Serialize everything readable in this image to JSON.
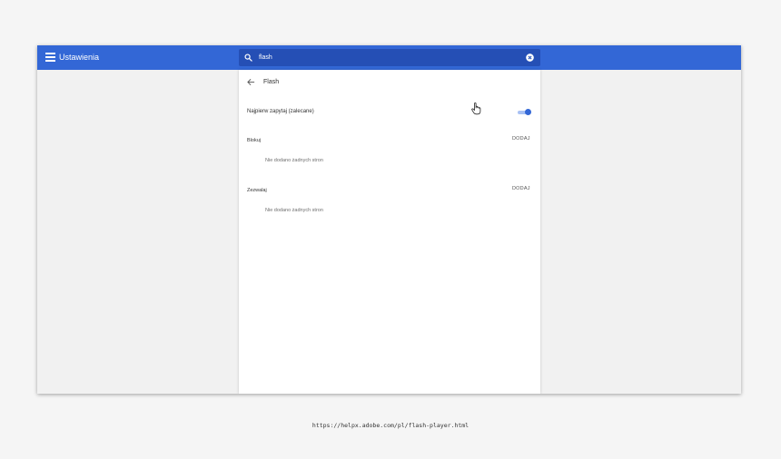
{
  "header": {
    "title": "Ustawienia",
    "menu_icon": "hamburger-menu-icon",
    "accent_color": "#3367d6"
  },
  "search": {
    "value": "flash",
    "search_icon": "search-icon",
    "clear_icon": "clear-search-icon"
  },
  "panel": {
    "back_icon": "back-arrow-icon",
    "title": "Flash",
    "ask_first": {
      "label": "Najpierw zapytaj (zalecane)",
      "toggle_on": true
    },
    "block": {
      "label": "Blokuj",
      "add_label": "DODAJ",
      "empty_text": "Nie dodano żadnych stron"
    },
    "allow": {
      "label": "Zezwalaj",
      "add_label": "DODAJ",
      "empty_text": "Nie dodano żadnych stron"
    }
  },
  "caption": "https://helpx.adobe.com/pl/flash-player.html"
}
